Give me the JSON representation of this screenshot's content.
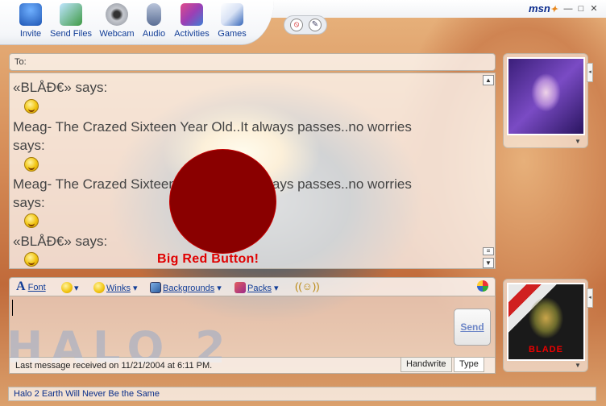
{
  "window": {
    "brand": "msn",
    "close_glyph": "✕",
    "min_glyph": "—",
    "max_glyph": "□"
  },
  "toolbar": {
    "items": [
      {
        "label": "Invite",
        "icon": "invite-icon",
        "color": "#2f6cc3"
      },
      {
        "label": "Send Files",
        "icon": "send-files-icon",
        "color": "#3f9a45"
      },
      {
        "label": "Webcam",
        "icon": "webcam-icon",
        "color": "#8a8f99"
      },
      {
        "label": "Audio",
        "icon": "microphone-icon",
        "color": "#5a6e94"
      },
      {
        "label": "Activities",
        "icon": "activities-icon",
        "color": "#9b3fb5"
      },
      {
        "label": "Games",
        "icon": "games-icon",
        "color": "#3466b8"
      }
    ]
  },
  "to": {
    "label": "To:"
  },
  "history": {
    "messages": [
      {
        "sender": "«BLÅÐ€» says:",
        "emoticon": "wink"
      },
      {
        "sender": "Meag- The Crazed Sixteen Year Old..It always passes..no worries",
        "sender_cont": "says:",
        "emoticon": "surprised"
      },
      {
        "sender": "Meag- The Crazed Sixteen Year Old..It always passes..no worries",
        "sender_cont": "says:",
        "emoticon": "tongue-out"
      },
      {
        "sender": "«BLÅÐ€» says:",
        "emoticon": "tongue-wink"
      }
    ]
  },
  "overlay": {
    "big_red_label": "Big Red Button!",
    "color": "#8a0000"
  },
  "format_toolbar": {
    "font": "Font",
    "winks": "Winks",
    "backgrounds": "Backgrounds",
    "packs": "Packs"
  },
  "compose": {
    "send": "Send",
    "watermark": "HALO 2"
  },
  "status": {
    "last_message": "Last message received on 11/21/2004 at 6:11 PM.",
    "handwrite": "Handwrite",
    "type": "Type"
  },
  "bottom_status": {
    "text": "Halo 2 Earth Will Never Be the Same"
  },
  "display_pictures": {
    "contact": {
      "label": "",
      "caption": ""
    },
    "self": {
      "caption": "BLADE"
    }
  }
}
